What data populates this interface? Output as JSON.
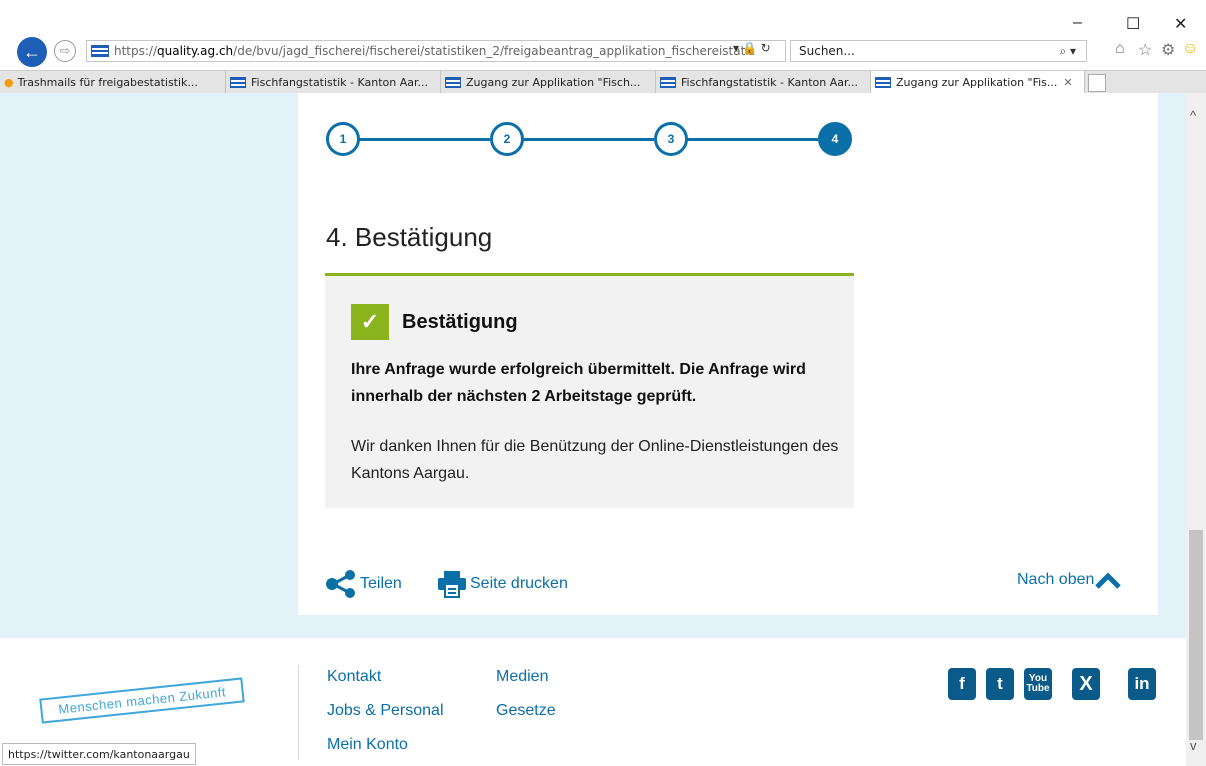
{
  "browser": {
    "url_proto": "https://",
    "url_host": "quality.ag.ch",
    "url_path": "/de/bvu/jagd_fischerei/fischerei/statistiken_2/freigabeantrag_applikation_fischereistatis",
    "search_placeholder": "Suchen...",
    "tabs": [
      {
        "label": "Trashmails für freigabestatistik..."
      },
      {
        "label": "Fischfangstatistik - Kanton Aar..."
      },
      {
        "label": "Zugang zur Applikation \"Fisch..."
      },
      {
        "label": "Fischfangstatistik - Kanton Aar..."
      },
      {
        "label": "Zugang zur Applikation \"Fis..."
      }
    ],
    "status_url": "https://twitter.com/kantonaargau"
  },
  "steps": [
    "1",
    "2",
    "3",
    "4"
  ],
  "page": {
    "title": "4. Bestätigung",
    "box_title": "Bestätigung",
    "box_bold": "Ihre Anfrage wurde erfolgreich übermittelt. Die Anfrage wird innerhalb der nächsten 2 Arbeitstage geprüft.",
    "box_text": "Wir danken Ihnen für die Benützung der Online-Dienstleistungen des Kantons Aargau.",
    "share": "Teilen",
    "print": "Seite drucken",
    "top": "Nach oben"
  },
  "footer": {
    "stamp": "Menschen machen Zukunft",
    "links": [
      "Kontakt",
      "Medien",
      "Jobs & Personal",
      "Gesetze",
      "Mein Konto"
    ],
    "social": [
      "facebook-icon",
      "twitter-icon",
      "youtube-icon",
      "xing-icon",
      "linkedin-icon"
    ]
  },
  "colors": {
    "accent": "#0b6fa8",
    "success": "#8ab31c",
    "page_bg": "#e3f1f9"
  }
}
